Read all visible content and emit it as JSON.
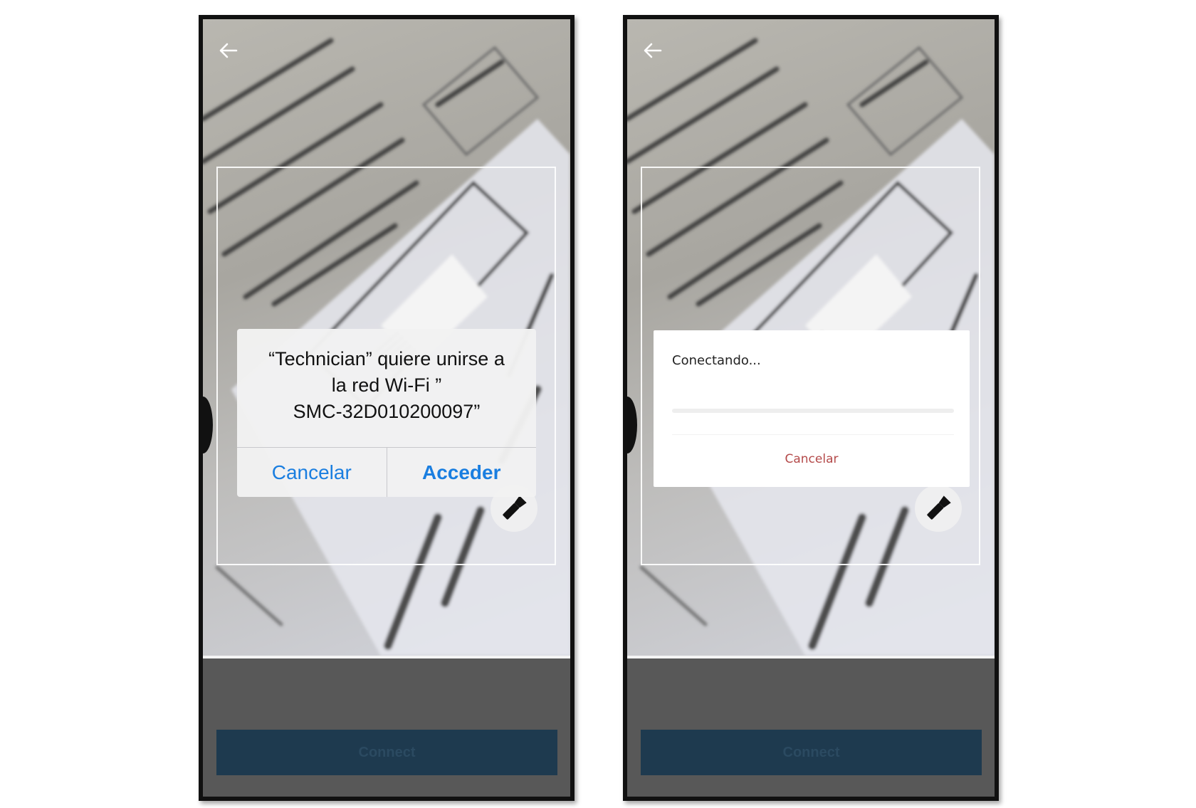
{
  "screens": [
    {
      "connect_label": "Connect",
      "dialog": {
        "title_lines": [
          "“Technician” quiere unirse a",
          "la red Wi-Fi ”",
          "SMC-32D010200097”"
        ],
        "cancel_label": "Cancelar",
        "accept_label": "Acceder"
      }
    },
    {
      "connect_label": "Connect",
      "progress": {
        "title": "Conectando...",
        "value": 0,
        "cancel_label": "Cancelar"
      }
    }
  ],
  "icons": {
    "back": "arrow-left-icon",
    "flash": "flashlight-icon"
  },
  "colors": {
    "ios_link": "#1a7ee0",
    "cancel_red": "#b44a4a",
    "connect_button": "#1e3a4f",
    "bottom_panel": "#585858"
  }
}
